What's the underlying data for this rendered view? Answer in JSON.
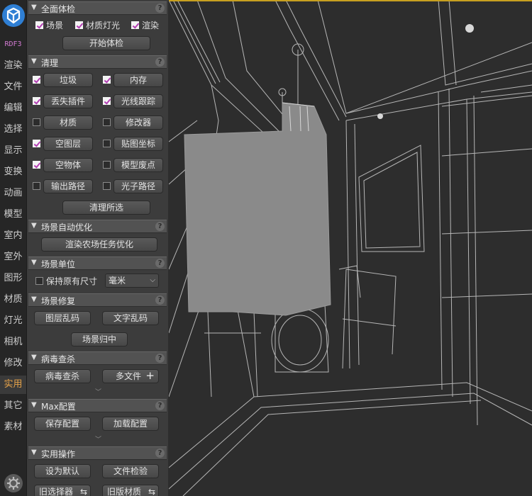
{
  "sidebar": {
    "logo_text": "RDF3",
    "items": [
      "渲染",
      "文件",
      "编辑",
      "选择",
      "显示",
      "变换",
      "动画",
      "模型",
      "室内",
      "室外",
      "图形",
      "材质",
      "灯光",
      "相机",
      "修改",
      "实用",
      "其它",
      "素材"
    ],
    "active_index": 15
  },
  "colors": {
    "accent": "#e8a44a",
    "check": "#b43fb4",
    "logo": "#2f7fd4"
  },
  "sections": {
    "full_check": {
      "title": "全面体检",
      "options": [
        {
          "label": "场景",
          "checked": true
        },
        {
          "label": "材质灯光",
          "checked": true
        },
        {
          "label": "渲染",
          "checked": true
        }
      ],
      "button": "开始体检"
    },
    "clean": {
      "title": "清理",
      "items": [
        {
          "label": "垃圾",
          "checked": true
        },
        {
          "label": "内存",
          "checked": true
        },
        {
          "label": "丢失插件",
          "checked": true
        },
        {
          "label": "光线跟踪",
          "checked": true
        },
        {
          "label": "材质",
          "checked": false
        },
        {
          "label": "修改器",
          "checked": false
        },
        {
          "label": "空图层",
          "checked": true
        },
        {
          "label": "贴图坐标",
          "checked": false
        },
        {
          "label": "空物体",
          "checked": true
        },
        {
          "label": "模型废点",
          "checked": false
        },
        {
          "label": "输出路径",
          "checked": false
        },
        {
          "label": "光子路径",
          "checked": false
        }
      ],
      "button": "清理所选"
    },
    "auto_opt": {
      "title": "场景自动优化",
      "button": "渲染农场任务优化"
    },
    "units": {
      "title": "场景单位",
      "keep_label": "保持原有尺寸",
      "keep_checked": false,
      "unit_value": "毫米"
    },
    "repair": {
      "title": "场景修复",
      "buttons": [
        "图层乱码",
        "文字乱码"
      ],
      "center_button": "场景归中"
    },
    "virus": {
      "title": "病毒查杀",
      "buttons": [
        "病毒查杀",
        "多文件"
      ],
      "plus": "+"
    },
    "max_config": {
      "title": "Max配置",
      "buttons": [
        "保存配置",
        "加载配置"
      ]
    },
    "util_ops": {
      "title": "实用操作",
      "buttons": [
        "设为默认",
        "文件检验",
        "旧选择器",
        "旧版材质"
      ],
      "swap": "⇆"
    }
  },
  "help_glyph": "?"
}
